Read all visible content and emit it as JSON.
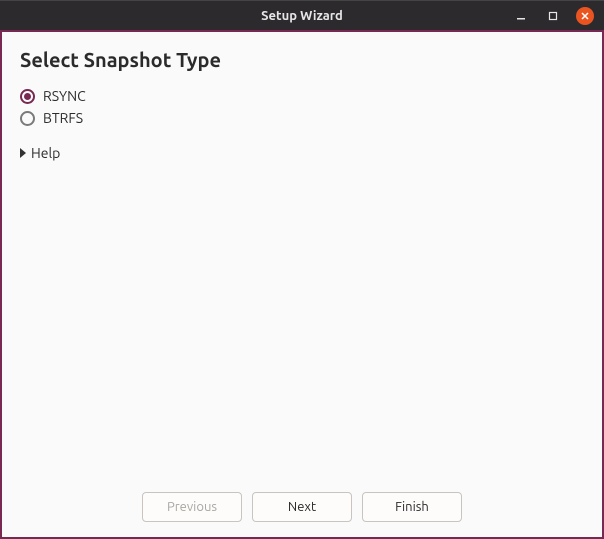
{
  "window": {
    "title": "Setup Wizard",
    "accent_color": "#772953",
    "close_color": "#e95420"
  },
  "page": {
    "heading": "Select Snapshot Type"
  },
  "options": {
    "rsync": {
      "label": "RSYNC",
      "selected": true
    },
    "btrfs": {
      "label": "BTRFS",
      "selected": false
    }
  },
  "expander": {
    "help_label": "Help",
    "expanded": false
  },
  "buttons": {
    "previous": {
      "label": "Previous",
      "enabled": false
    },
    "next": {
      "label": "Next",
      "enabled": true
    },
    "finish": {
      "label": "Finish",
      "enabled": true
    }
  }
}
